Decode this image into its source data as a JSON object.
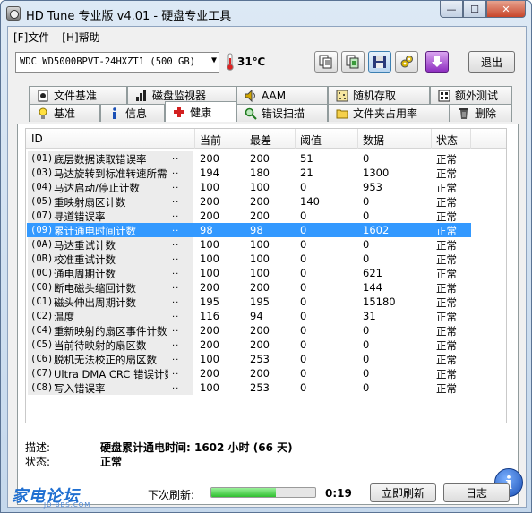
{
  "window": {
    "title": "HD Tune 专业版 v4.01 - 硬盘专业工具",
    "min_label": "—",
    "max_label": "☐",
    "close_label": "✕"
  },
  "menu": [
    {
      "label": "[F]文件"
    },
    {
      "label": "[H]帮助"
    }
  ],
  "toolbar": {
    "drive": "WDC WD5000BPVT-24HXZT1 (500 GB)",
    "temperature": "31℃",
    "exit_label": "退出"
  },
  "tabs_row1": [
    {
      "label": "文件基准",
      "icon": "file-benchmark-icon"
    },
    {
      "label": "磁盘监视器",
      "icon": "disk-monitor-icon"
    },
    {
      "label": "AAM",
      "icon": "speaker-icon"
    },
    {
      "label": "随机存取",
      "icon": "random-access-icon"
    },
    {
      "label": "额外测试",
      "icon": "extra-tests-icon"
    }
  ],
  "tabs_row2": [
    {
      "label": "基准",
      "icon": "benchmark-bulb-icon"
    },
    {
      "label": "信息",
      "icon": "info-icon"
    },
    {
      "label": "健康",
      "icon": "health-cross-icon",
      "active": true
    },
    {
      "label": "错误扫描",
      "icon": "error-scan-icon"
    },
    {
      "label": "文件夹占用率",
      "icon": "folder-icon"
    },
    {
      "label": "删除",
      "icon": "trash-icon"
    }
  ],
  "table": {
    "headers": [
      "ID",
      "当前",
      "最差",
      "阈值",
      "数据",
      "状态"
    ],
    "rows": [
      {
        "id": "(01)",
        "name": "底层数据读取错误率",
        "current": "200",
        "worst": "200",
        "threshold": "51",
        "data": "0",
        "status": "正常"
      },
      {
        "id": "(03)",
        "name": "马达旋转到标准转速所需",
        "current": "194",
        "worst": "180",
        "threshold": "21",
        "data": "1300",
        "status": "正常"
      },
      {
        "id": "(04)",
        "name": "马达启动/停止计数",
        "current": "100",
        "worst": "100",
        "threshold": "0",
        "data": "953",
        "status": "正常"
      },
      {
        "id": "(05)",
        "name": "重映射扇区计数",
        "current": "200",
        "worst": "200",
        "threshold": "140",
        "data": "0",
        "status": "正常"
      },
      {
        "id": "(07)",
        "name": "寻道错误率",
        "current": "200",
        "worst": "200",
        "threshold": "0",
        "data": "0",
        "status": "正常"
      },
      {
        "id": "(09)",
        "name": "累计通电时间计数",
        "current": "98",
        "worst": "98",
        "threshold": "0",
        "data": "1602",
        "status": "正常",
        "selected": true
      },
      {
        "id": "(0A)",
        "name": "马达重试计数",
        "current": "100",
        "worst": "100",
        "threshold": "0",
        "data": "0",
        "status": "正常"
      },
      {
        "id": "(0B)",
        "name": "校准重试计数",
        "current": "100",
        "worst": "100",
        "threshold": "0",
        "data": "0",
        "status": "正常"
      },
      {
        "id": "(0C)",
        "name": "通电周期计数",
        "current": "100",
        "worst": "100",
        "threshold": "0",
        "data": "621",
        "status": "正常"
      },
      {
        "id": "(C0)",
        "name": "断电磁头缩回计数",
        "current": "200",
        "worst": "200",
        "threshold": "0",
        "data": "144",
        "status": "正常"
      },
      {
        "id": "(C1)",
        "name": "磁头伸出周期计数",
        "current": "195",
        "worst": "195",
        "threshold": "0",
        "data": "15180",
        "status": "正常"
      },
      {
        "id": "(C2)",
        "name": "温度",
        "current": "116",
        "worst": "94",
        "threshold": "0",
        "data": "31",
        "status": "正常"
      },
      {
        "id": "(C4)",
        "name": "重新映射的扇区事件计数",
        "current": "200",
        "worst": "200",
        "threshold": "0",
        "data": "0",
        "status": "正常"
      },
      {
        "id": "(C5)",
        "name": "当前待映射的扇区数",
        "current": "200",
        "worst": "200",
        "threshold": "0",
        "data": "0",
        "status": "正常"
      },
      {
        "id": "(C6)",
        "name": "脱机无法校正的扇区数",
        "current": "100",
        "worst": "253",
        "threshold": "0",
        "data": "0",
        "status": "正常"
      },
      {
        "id": "(C7)",
        "name": "Ultra DMA CRC 错误计数",
        "current": "200",
        "worst": "200",
        "threshold": "0",
        "data": "0",
        "status": "正常"
      },
      {
        "id": "(C8)",
        "name": "写入错误率",
        "current": "100",
        "worst": "253",
        "threshold": "0",
        "data": "0",
        "status": "正常"
      }
    ]
  },
  "details": {
    "desc_label": "描述:",
    "desc_value": "硬盘累计通电时间: 1602 小时 (66 天)",
    "status_label": "状态:",
    "status_value": "正常"
  },
  "bottom": {
    "watermark": "家电论坛",
    "watermark_sub": "JD-BBS.COM",
    "next_refresh_label": "下次刷新:",
    "progress_fraction": 0.62,
    "countdown": "0:19",
    "refresh_now_label": "立即刷新",
    "log_label": "日志"
  },
  "colors": {
    "selection": "#3399ff",
    "progress": "#2fbf2f",
    "health_icon": "#d32020"
  }
}
